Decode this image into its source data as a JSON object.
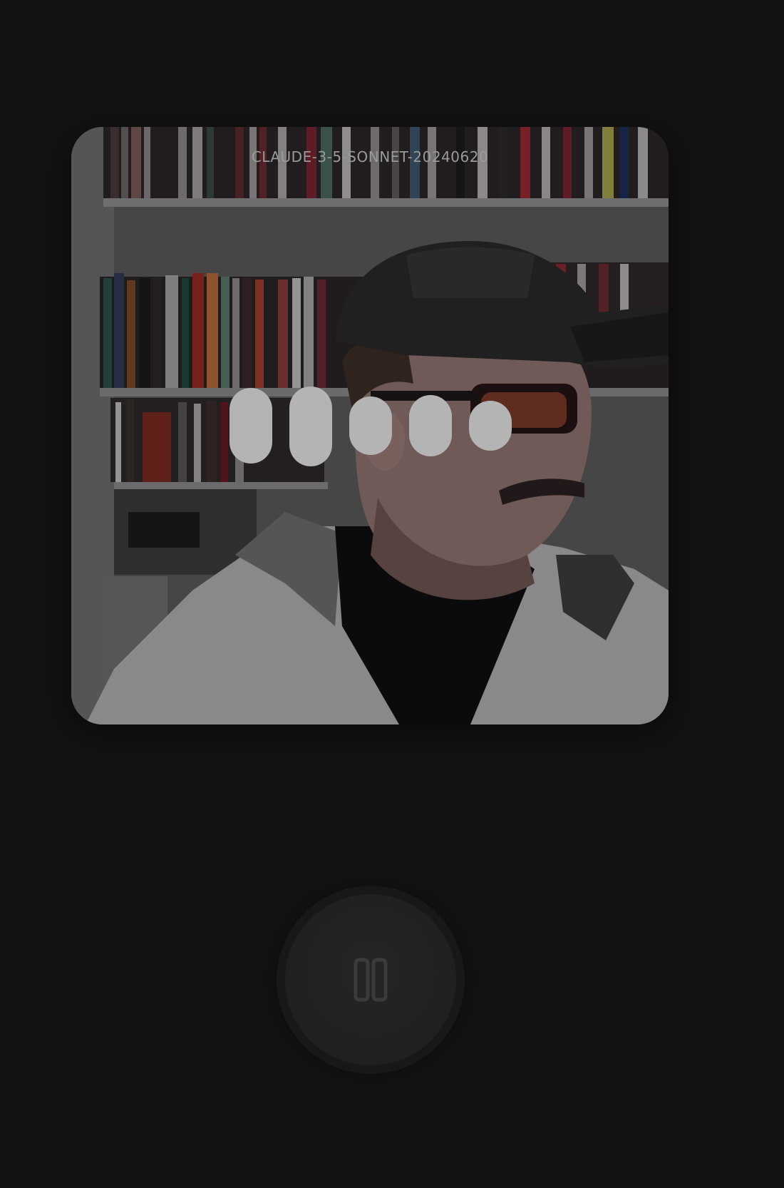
{
  "app": {
    "model_label": "CLAUDE-3-5-SONNET-20240620"
  },
  "voice_indicator": {
    "state": "speaking",
    "bar_count": 5,
    "color": "#b4b4b4"
  },
  "controls": {
    "pause_button_icon": "pause-icon",
    "background": "#131315"
  }
}
